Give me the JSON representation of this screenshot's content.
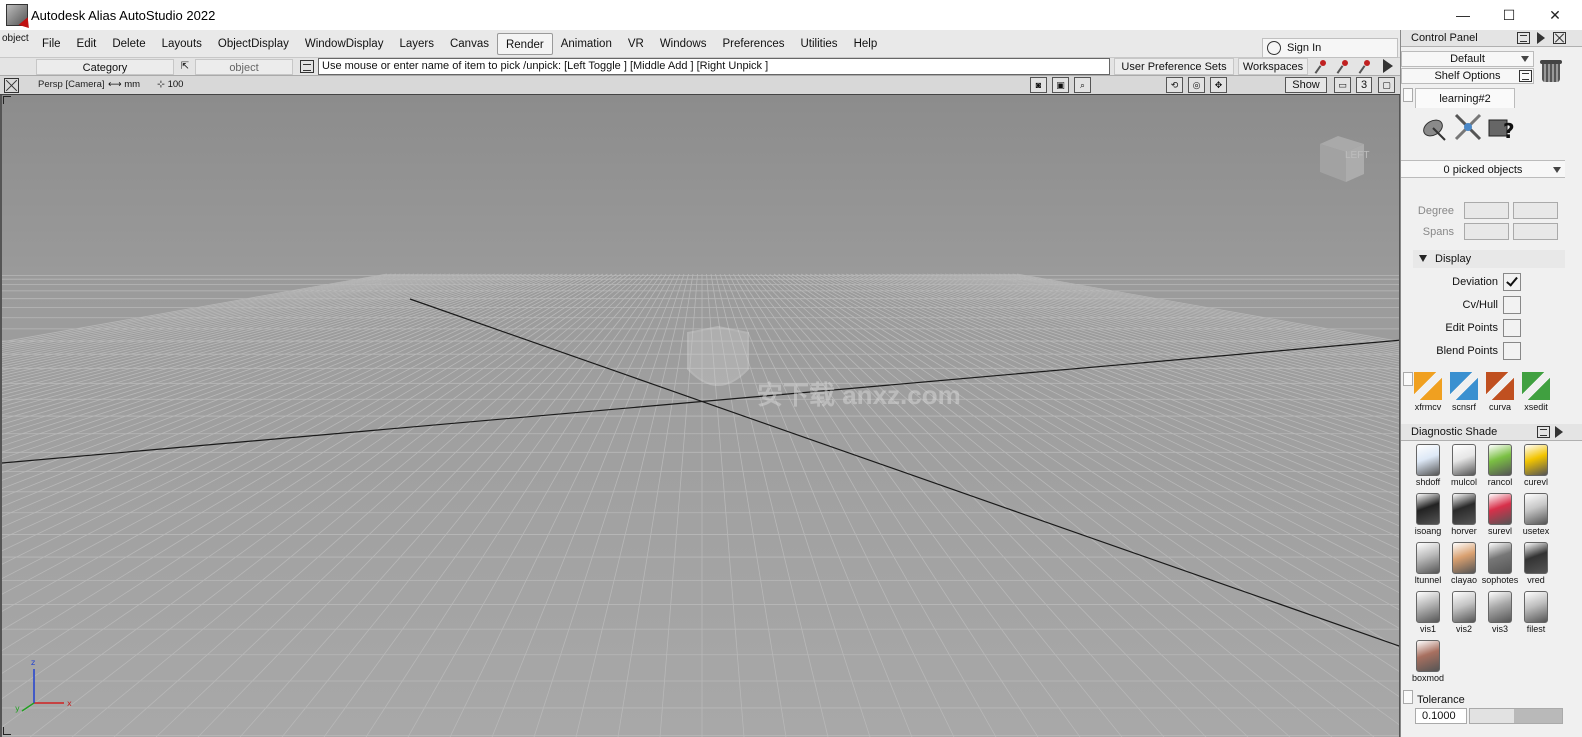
{
  "window": {
    "title": "Autodesk Alias AutoStudio 2022",
    "logo_letter": "A",
    "minimize": "—",
    "maximize": "☐",
    "close": "✕"
  },
  "toolbar": {
    "object_tool_label": "object",
    "menus": [
      "File",
      "Edit",
      "Delete",
      "Layouts",
      "ObjectDisplay",
      "WindowDisplay",
      "Layers",
      "Canvas",
      "Render",
      "Animation",
      "VR",
      "Windows",
      "Preferences",
      "Utilities",
      "Help"
    ],
    "active_menu": "Render",
    "sign_in": "Sign In"
  },
  "prompt_row": {
    "category": "Category",
    "object_field": "object",
    "prompt": "Use mouse or enter name of item to pick /unpick: [Left Toggle ] [Middle Add ] [Right Unpick ]",
    "user_pref_sets": "User Preference Sets",
    "workspaces": "Workspaces"
  },
  "viewport": {
    "camera": "Persp [Camera]",
    "units": "mm",
    "scale": "100",
    "show": "Show",
    "view_number": "3",
    "viewcube_face": "LEFT",
    "watermark": "安下载 anxz.com",
    "axis": {
      "x": "x",
      "y": "y",
      "z": "z"
    }
  },
  "control_panel": {
    "title": "Control Panel",
    "default_dropdown": "Default",
    "shelf_options": "Shelf Options",
    "shelf_tab": "learning#2",
    "picked": "0 picked objects",
    "degree_label": "Degree",
    "spans_label": "Spans",
    "display_section": "Display",
    "display_items": [
      {
        "label": "Deviation",
        "checked": true
      },
      {
        "label": "Cv/Hull",
        "checked": false
      },
      {
        "label": "Edit Points",
        "checked": false
      },
      {
        "label": "Blend Points",
        "checked": false
      }
    ],
    "palette": [
      "xfrmcv",
      "scnsrf",
      "curva",
      "xsedit"
    ],
    "diagnostic_title": "Diagnostic Shade",
    "diagnostic_items": [
      {
        "label": "shdoff",
        "color": "#dde8f6"
      },
      {
        "label": "mulcol",
        "color": "#e6e6e6"
      },
      {
        "label": "rancol",
        "color": "#7bc043"
      },
      {
        "label": "curevl",
        "color": "#f2c400"
      },
      {
        "label": "isoang",
        "color": "#222222"
      },
      {
        "label": "horver",
        "color": "#2a2a2a"
      },
      {
        "label": "surevl",
        "color": "#d8304a"
      },
      {
        "label": "usetex",
        "color": "#c8c8c8"
      },
      {
        "label": "ltunnel",
        "color": "#bbbbbb"
      },
      {
        "label": "clayao",
        "color": "#d9a070"
      },
      {
        "label": "sophotes",
        "color": "#777777"
      },
      {
        "label": "vred",
        "color": "#333333"
      },
      {
        "label": "vis1",
        "color": "#b5b5b5"
      },
      {
        "label": "vis2",
        "color": "#c5c5c5"
      },
      {
        "label": "vis3",
        "color": "#a8a8a8"
      },
      {
        "label": "filest",
        "color": "#bfbfbf"
      },
      {
        "label": "boxmod",
        "color": "#a87060"
      }
    ],
    "tolerance_label": "Tolerance",
    "tolerance_value": "0.1000"
  }
}
